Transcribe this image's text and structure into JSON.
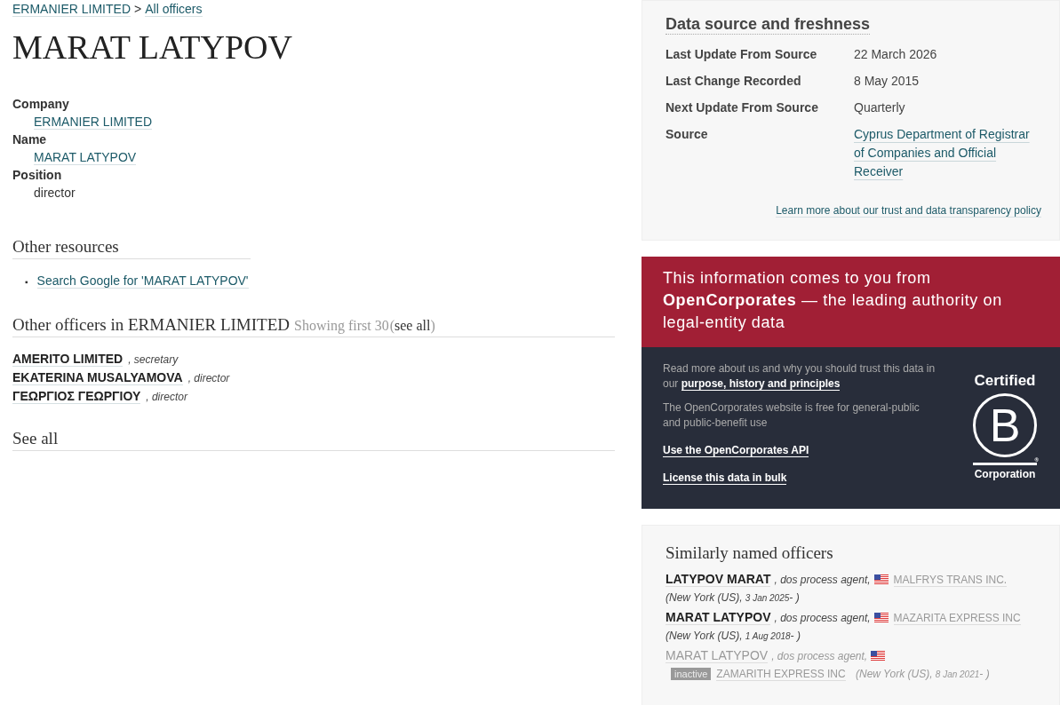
{
  "breadcrumb": {
    "company": "ERMANIER LIMITED",
    "separator": ">",
    "link": "All officers"
  },
  "title": "MARAT LATYPOV",
  "attributes": [
    {
      "label": "Company",
      "value": "ERMANIER LIMITED",
      "link": true
    },
    {
      "label": "Name",
      "value": "MARAT LATYPOV",
      "link": true
    },
    {
      "label": "Position",
      "value": "director",
      "link": false
    }
  ],
  "other_resources": {
    "heading": "Other resources",
    "bullet": "▪",
    "links": [
      "Search Google for 'MARAT LATYPOV'"
    ]
  },
  "other_officers": {
    "heading": "Other officers in ERMANIER LIMITED",
    "showing": "Showing first 30",
    "see_all_open": "(",
    "see_all": "see all",
    "see_all_close": ")",
    "officers": [
      {
        "name": "AMERITO LIMITED",
        "role": ", secretary"
      },
      {
        "name": "EKATERINA MUSALYAMOVA",
        "role": ", director"
      },
      {
        "name": "ΓΕΩΡΓΙΟΣ ΓΕΩΡΓΙΟΥ",
        "role": ", director"
      }
    ]
  },
  "see_all_heading": "See all",
  "data_source": {
    "heading": "Data source and freshness",
    "rows": [
      {
        "label": "Last Update From Source",
        "value": "22 March 2026",
        "link": false
      },
      {
        "label": "Last Change Recorded",
        "value": "8 May 2015",
        "link": false
      },
      {
        "label": "Next Update From Source",
        "value": "Quarterly",
        "link": false
      },
      {
        "label": "Source",
        "value": "Cyprus Department of Registrar of Companies and Official Receiver",
        "link": true
      }
    ],
    "policy_link": "Learn more about our trust and data transparency policy"
  },
  "banner": {
    "text": "This information comes to you from **OpenCorporates** — the leading authority on legal-entity data"
  },
  "about": {
    "paragraphs": [
      {
        "text": "Read more about us and why you should trust this data in our ",
        "link": "purpose, history and principles"
      },
      {
        "text": "The OpenCorporates website is free for general-public and public-benefit use"
      }
    ],
    "links": [
      "Use the OpenCorporates API",
      "License this data in bulk"
    ],
    "logo": {
      "top": "Certified",
      "letter": "B",
      "mark": "®",
      "bottom": "Corporation"
    }
  },
  "similar": {
    "heading": "Similarly named officers",
    "officers": [
      {
        "name": "LATYPOV MARAT",
        "role": ", dos process agent,",
        "company": "MALFRYS TRANS INC.",
        "place": "(New York (US), ",
        "date": "3 Jan 2025",
        "end": "- )",
        "active": true
      },
      {
        "name": "MARAT LATYPOV",
        "role": ", dos process agent,",
        "company": "MAZARITA EXPRESS INC",
        "place": "(New York (US), ",
        "date": "1 Aug 2018",
        "end": "- )",
        "active": true
      },
      {
        "name": "MARAT LATYPOV",
        "role": ", dos process agent,",
        "badge": "inactive",
        "company": "ZAMARITH EXPRESS INC",
        "place": "(New York (US), ",
        "date": "8 Jan 2021",
        "end": "- )",
        "active": false
      }
    ]
  }
}
